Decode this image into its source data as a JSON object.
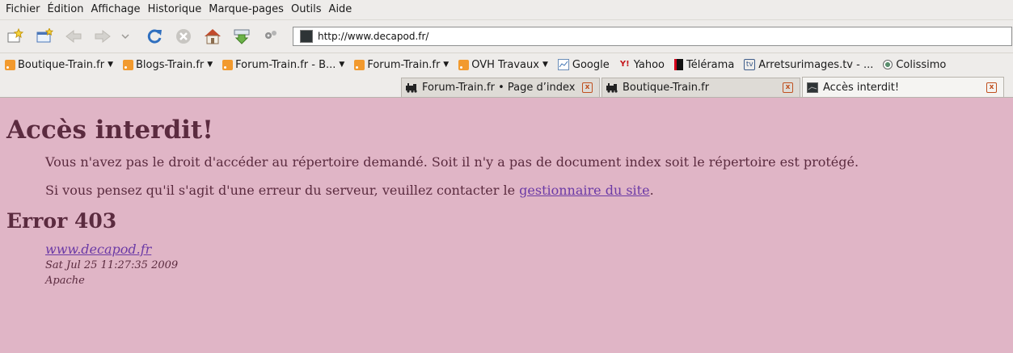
{
  "menu": [
    "Fichier",
    "Édition",
    "Affichage",
    "Historique",
    "Marque-pages",
    "Outils",
    "Aide"
  ],
  "navbar": {
    "url": "http://www.decapod.fr/"
  },
  "bookmarks": [
    {
      "label": "Boutique-Train.fr",
      "icon": "rss-icon",
      "folder": true
    },
    {
      "label": "Blogs-Train.fr",
      "icon": "rss-icon",
      "folder": true
    },
    {
      "label": "Forum-Train.fr - B...",
      "icon": "rss-icon",
      "folder": true
    },
    {
      "label": "Forum-Train.fr",
      "icon": "rss-icon",
      "folder": true
    },
    {
      "label": "OVH Travaux",
      "icon": "rss-icon",
      "folder": true
    },
    {
      "label": "Google",
      "icon": "google-icon",
      "folder": false
    },
    {
      "label": "Yahoo",
      "icon": "yahoo-icon",
      "folder": false
    },
    {
      "label": "Télérama",
      "icon": "telerama-icon",
      "folder": false
    },
    {
      "label": "Arretsurimages.tv - ...",
      "icon": "tv-icon",
      "folder": false
    },
    {
      "label": "Colissimo",
      "icon": "colissimo-icon",
      "folder": false
    }
  ],
  "tabs": [
    {
      "label": "Forum-Train.fr • Page d’index",
      "icon": "train-icon",
      "active": false
    },
    {
      "label": "Boutique-Train.fr",
      "icon": "train-icon",
      "active": false
    },
    {
      "label": "Accès interdit!",
      "icon": "page-icon",
      "active": true
    }
  ],
  "page": {
    "title": "Accès interdit!",
    "p1": "Vous n'avez pas le droit d'accéder au répertoire demandé. Soit il n'y a pas de document index soit le répertoire est protégé.",
    "p2_before": "Si vous pensez qu'il s'agit d'une erreur du serveur, veuillez contacter le ",
    "p2_link": "gestionnaire du site",
    "p2_after": ".",
    "error": "Error 403",
    "host": "www.decapod.fr",
    "date": "Sat Jul 25 11:27:35 2009",
    "server": "Apache"
  },
  "colors": {
    "page_bg": "#e0b5c6",
    "text": "#5b2b3f",
    "link": "#6b3aa6"
  }
}
